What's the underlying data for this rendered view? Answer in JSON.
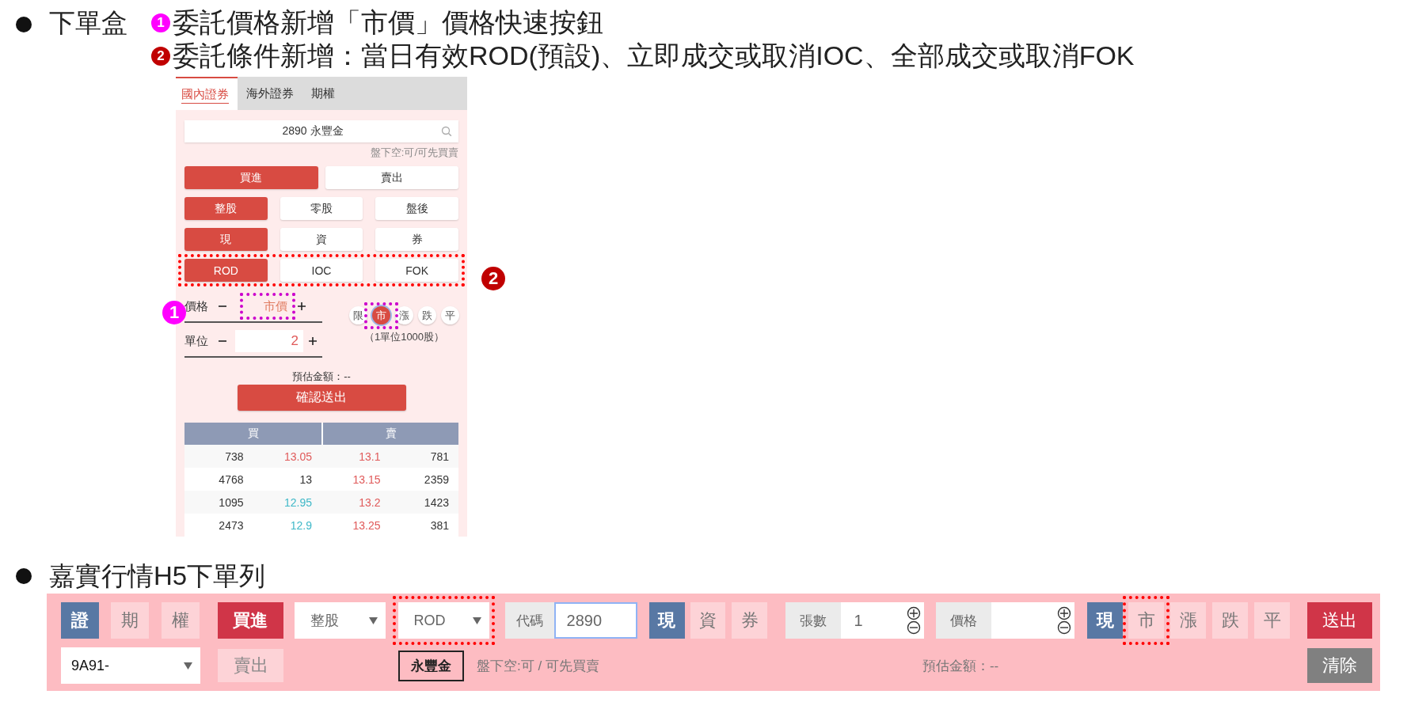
{
  "section_1": {
    "title": "下單盒",
    "notes": [
      {
        "marker": "1",
        "color": "#ff00ff",
        "text": "委託價格新增「市價」價格快速按鈕"
      },
      {
        "marker": "2",
        "color": "#c00000",
        "text": "委託條件新增：當日有效ROD(預設)、立即成交或取消IOC、全部成交或取消FOK"
      }
    ],
    "panel": {
      "tabs": [
        {
          "label": "國內證券",
          "selected": true
        },
        {
          "label": "海外證券",
          "selected": false
        },
        {
          "label": "期權",
          "selected": false
        }
      ],
      "search": {
        "value": "2890 永豐金"
      },
      "short_sell_note": "盤下空:可/可先買賣",
      "button_groups": [
        {
          "options": [
            {
              "label": "買進",
              "selected": true
            },
            {
              "label": "賣出",
              "selected": false
            }
          ]
        },
        {
          "options": [
            {
              "label": "整股",
              "selected": true
            },
            {
              "label": "零股",
              "selected": false
            },
            {
              "label": "盤後",
              "selected": false
            }
          ]
        },
        {
          "options": [
            {
              "label": "現",
              "selected": true
            },
            {
              "label": "資",
              "selected": false
            },
            {
              "label": "券",
              "selected": false
            }
          ]
        },
        {
          "highlighted": true,
          "options": [
            {
              "label": "ROD",
              "selected": true
            },
            {
              "label": "IOC",
              "selected": false
            },
            {
              "label": "FOK",
              "selected": false
            }
          ]
        }
      ],
      "price": {
        "label": "價格",
        "value": "市價",
        "highlighted": true
      },
      "unit": {
        "label": "單位",
        "value": "2"
      },
      "quick_prices": [
        {
          "label": "限",
          "selected": false
        },
        {
          "label": "市",
          "selected": true,
          "highlighted": true
        },
        {
          "label": "漲",
          "selected": false
        },
        {
          "label": "跌",
          "selected": false
        },
        {
          "label": "平",
          "selected": false
        }
      ],
      "unit_note": "（1單位1000股）",
      "estimate": "預估金額：--",
      "submit": "確認送出",
      "order_book": {
        "columns": [
          "買",
          "賣"
        ],
        "rows": [
          {
            "cells": [
              {
                "text": "738"
              },
              {
                "text": "13.05",
                "color": "#e05a5a"
              },
              {
                "text": "13.1",
                "color": "#e05a5a"
              },
              {
                "text": "781"
              }
            ]
          },
          {
            "cells": [
              {
                "text": "4768"
              },
              {
                "text": "13",
                "color": "#333333"
              },
              {
                "text": "13.15",
                "color": "#e05a5a"
              },
              {
                "text": "2359"
              }
            ]
          },
          {
            "cells": [
              {
                "text": "1095"
              },
              {
                "text": "12.95",
                "color": "#3fb8c8"
              },
              {
                "text": "13.2",
                "color": "#e05a5a"
              },
              {
                "text": "1423"
              }
            ]
          },
          {
            "cells": [
              {
                "text": "2473"
              },
              {
                "text": "12.9",
                "color": "#3fb8c8"
              },
              {
                "text": "13.25",
                "color": "#e05a5a"
              },
              {
                "text": "381"
              }
            ]
          }
        ]
      },
      "callouts": [
        {
          "marker": "1",
          "color": "#ff00ff"
        },
        {
          "marker": "2",
          "color": "#c00000"
        }
      ]
    }
  },
  "section_2": {
    "title": "嘉實行情H5下單列",
    "row_1": [
      {
        "kind": "toggle",
        "label": "證",
        "selected": true
      },
      {
        "kind": "toggle",
        "label": "期",
        "selected": false
      },
      {
        "kind": "toggle",
        "label": "權",
        "selected": false
      },
      {
        "kind": "side",
        "label": "買進",
        "selected": true
      },
      {
        "kind": "select",
        "value": "整股"
      },
      {
        "kind": "select",
        "value": "ROD",
        "highlighted": true
      },
      {
        "kind": "field",
        "label": "代碼",
        "value": "2890",
        "focused": true
      },
      {
        "kind": "toggle",
        "label": "現",
        "selected": true
      },
      {
        "kind": "toggle",
        "label": "資",
        "selected": false
      },
      {
        "kind": "toggle",
        "label": "券",
        "selected": false
      },
      {
        "kind": "stepper",
        "label": "張數",
        "value": "1"
      },
      {
        "kind": "stepper",
        "label": "價格"
      },
      {
        "kind": "toggle",
        "label": "現",
        "selected": true
      },
      {
        "kind": "toggle",
        "label": "市",
        "selected": false,
        "highlighted": true
      },
      {
        "kind": "toggle",
        "label": "漲",
        "selected": false
      },
      {
        "kind": "toggle",
        "label": "跌",
        "selected": false
      },
      {
        "kind": "toggle",
        "label": "平",
        "selected": false
      },
      {
        "kind": "submit",
        "label": "送出"
      }
    ],
    "row_2": [
      {
        "kind": "select",
        "value": "9A91-"
      },
      {
        "kind": "side",
        "label": "賣出",
        "selected": false
      },
      {
        "kind": "stock",
        "label": "永豐金"
      },
      {
        "kind": "note",
        "text": "盤下空:可 / 可先買賣"
      },
      {
        "kind": "estimate",
        "text": "預估金額：--"
      },
      {
        "kind": "clear",
        "label": "清除"
      }
    ]
  }
}
